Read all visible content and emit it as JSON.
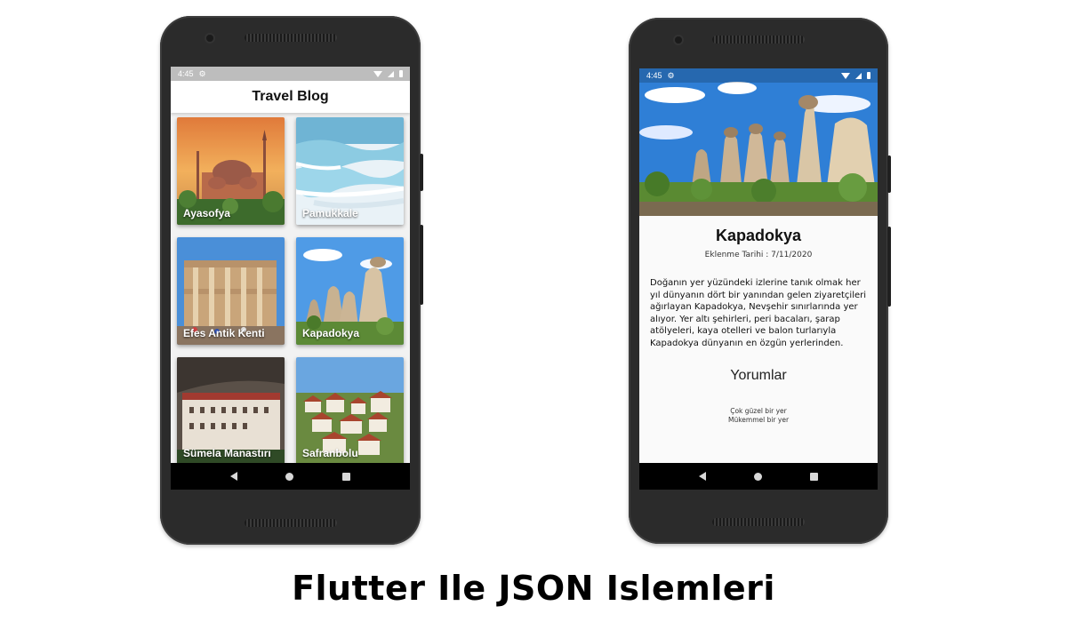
{
  "list_screen": {
    "status": {
      "time": "4:45"
    },
    "appbar_title": "Travel Blog",
    "places": [
      {
        "name": "Ayasofya"
      },
      {
        "name": "Pamukkale"
      },
      {
        "name": "Efes Antik Kenti"
      },
      {
        "name": "Kapadokya"
      },
      {
        "name": "Sümela Manastırı"
      },
      {
        "name": "Safranbolu"
      }
    ]
  },
  "detail_screen": {
    "status": {
      "time": "4:45"
    },
    "title": "Kapadokya",
    "date": "Eklenme Tarihi : 7/11/2020",
    "description": "Doğanın yer yüzündeki izlerine tanık olmak her yıl dünyanın dört bir yanından gelen ziyaretçileri ağırlayan Kapadokya, Nevşehir sınırlarında yer alıyor. Yer altı şehirleri, peri bacaları, şarap atölyeleri, kaya otelleri ve balon turlarıyla Kapadokya dünyanın en özgün yerlerinden.",
    "comments_title": "Yorumlar",
    "comments": [
      "Çok güzel bir yer",
      "Mükemmel bir yer"
    ]
  },
  "caption": "Flutter Ile JSON Islemleri",
  "icons": {
    "status": [
      "gear-icon",
      "wifi-icon",
      "signal-icon",
      "battery-icon"
    ],
    "nav": [
      "back-icon",
      "home-icon",
      "recents-icon"
    ]
  },
  "colors": {
    "status_bar": "#bdbdbd",
    "nav_bar": "#000000",
    "device_body": "#2b2b2b"
  }
}
